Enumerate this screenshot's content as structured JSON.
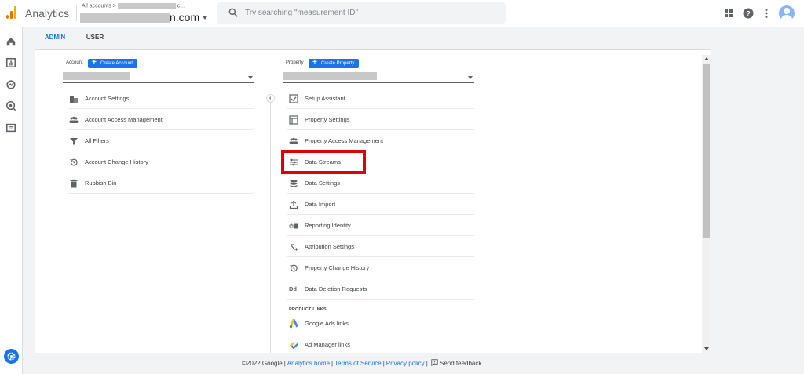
{
  "header": {
    "app_title": "Analytics",
    "breadcrumb_small": "All accounts >",
    "breadcrumb_small_suffix": "c...",
    "breadcrumb_big_suffix": "n.com",
    "search_placeholder": "Try searching \"measurement ID\""
  },
  "tabs": [
    {
      "label": "ADMIN",
      "active": true
    },
    {
      "label": "USER",
      "active": false
    }
  ],
  "account": {
    "label": "Account",
    "create_label": "Create Account",
    "items": [
      {
        "label": "Account Settings",
        "icon": "building-icon"
      },
      {
        "label": "Account Access Management",
        "icon": "people-icon"
      },
      {
        "label": "All Filters",
        "icon": "filter-icon"
      },
      {
        "label": "Account Change History",
        "icon": "history-icon"
      },
      {
        "label": "Rubbish Bin",
        "icon": "trash-icon"
      }
    ]
  },
  "property": {
    "label": "Property",
    "create_label": "Create Property",
    "items": [
      {
        "label": "Setup Assistant",
        "icon": "checkbox-icon"
      },
      {
        "label": "Property Settings",
        "icon": "layout-icon"
      },
      {
        "label": "Property Access Management",
        "icon": "people-icon"
      },
      {
        "label": "Data Streams",
        "icon": "streams-icon"
      },
      {
        "label": "Data Settings",
        "icon": "database-icon"
      },
      {
        "label": "Data Import",
        "icon": "upload-icon"
      },
      {
        "label": "Reporting Identity",
        "icon": "identity-icon"
      },
      {
        "label": "Attribution Settings",
        "icon": "attribution-icon"
      },
      {
        "label": "Property Change History",
        "icon": "history-icon"
      },
      {
        "label": "Data Deletion Requests",
        "icon": "dd-icon"
      }
    ],
    "dd_glyph": "Dd",
    "product_links_heading": "PRODUCT LINKS",
    "product_links": [
      {
        "label": "Google Ads links",
        "icon": "google-ads-icon"
      },
      {
        "label": "Ad Manager links",
        "icon": "ad-manager-icon"
      }
    ]
  },
  "footer": {
    "copyright": "©2022 Google",
    "links": [
      "Analytics home",
      "Terms of Service",
      "Privacy policy"
    ],
    "feedback": "Send feedback"
  },
  "colors": {
    "accent": "#1a73e8",
    "highlight": "#e00000",
    "logo_orange": "#f9ab00"
  }
}
